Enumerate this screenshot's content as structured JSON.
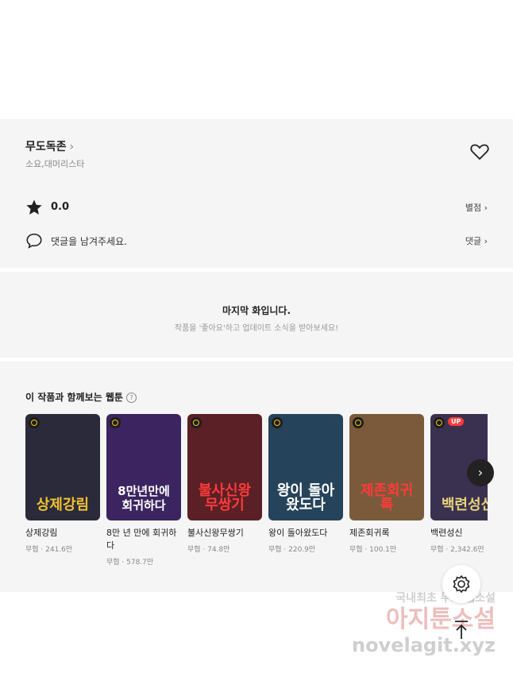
{
  "work": {
    "title": "무도독존",
    "chevron": "›",
    "author": "소요,대머리스타"
  },
  "rating": {
    "score": "0.0",
    "link": "별점"
  },
  "comment": {
    "prompt": "댓글을 남겨주세요.",
    "link": "댓글"
  },
  "last_episode": {
    "heading": "마지막 화입니다.",
    "sub": "작품을 '좋아요'하고 업데이트 소식을 받아보세요!"
  },
  "recommend": {
    "heading": "이 작품과 함께보는 웹툰",
    "help": "?",
    "items": [
      {
        "title": "상제강림",
        "meta": "무협 · 241.6만",
        "cover_text": "상제강림",
        "cover_bg": "#2a2a3a",
        "cover_fg": "#f2c230"
      },
      {
        "title": "8만 년 만에 회귀하다",
        "meta": "무협 · 578.7만",
        "cover_text": "8만년만에 회귀하다",
        "cover_bg": "#3b2460",
        "cover_fg": "#ffffff"
      },
      {
        "title": "불사신왕무쌍기",
        "meta": "무협 · 74.8만",
        "cover_text": "불사신왕무쌍기",
        "cover_bg": "#5a2025",
        "cover_fg": "#ff3a3a"
      },
      {
        "title": "왕이 돌아왔도다",
        "meta": "무협 · 220.9만",
        "cover_text": "왕이 돌아왔도다",
        "cover_bg": "#25435a",
        "cover_fg": "#ffffff"
      },
      {
        "title": "제존회귀록",
        "meta": "무협 · 100.1만",
        "cover_text": "제존회귀록",
        "cover_bg": "#7a5a3a",
        "cover_fg": "#ff3a3a"
      },
      {
        "title": "백련성신",
        "meta": "무협 · 2,342.6만",
        "cover_text": "백련성신",
        "cover_bg": "#3a3050",
        "cover_fg": "#e9d37a",
        "badge": "UP"
      }
    ]
  },
  "watermark": {
    "line1": "국내최초 무료 웹소설",
    "line2": "아지툰소설",
    "line3": "novelagit.xyz"
  }
}
